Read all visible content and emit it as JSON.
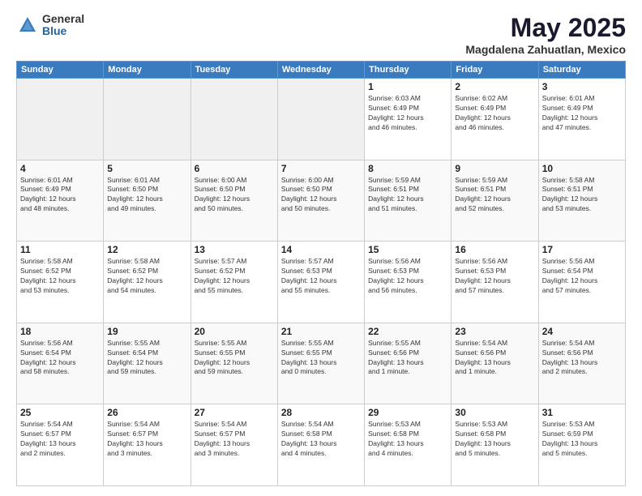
{
  "logo": {
    "general": "General",
    "blue": "Blue"
  },
  "title": {
    "month": "May 2025",
    "location": "Magdalena Zahuatlan, Mexico"
  },
  "days_of_week": [
    "Sunday",
    "Monday",
    "Tuesday",
    "Wednesday",
    "Thursday",
    "Friday",
    "Saturday"
  ],
  "weeks": [
    [
      {
        "day": "",
        "info": ""
      },
      {
        "day": "",
        "info": ""
      },
      {
        "day": "",
        "info": ""
      },
      {
        "day": "",
        "info": ""
      },
      {
        "day": "1",
        "info": "Sunrise: 6:03 AM\nSunset: 6:49 PM\nDaylight: 12 hours\nand 46 minutes."
      },
      {
        "day": "2",
        "info": "Sunrise: 6:02 AM\nSunset: 6:49 PM\nDaylight: 12 hours\nand 46 minutes."
      },
      {
        "day": "3",
        "info": "Sunrise: 6:01 AM\nSunset: 6:49 PM\nDaylight: 12 hours\nand 47 minutes."
      }
    ],
    [
      {
        "day": "4",
        "info": "Sunrise: 6:01 AM\nSunset: 6:49 PM\nDaylight: 12 hours\nand 48 minutes."
      },
      {
        "day": "5",
        "info": "Sunrise: 6:01 AM\nSunset: 6:50 PM\nDaylight: 12 hours\nand 49 minutes."
      },
      {
        "day": "6",
        "info": "Sunrise: 6:00 AM\nSunset: 6:50 PM\nDaylight: 12 hours\nand 50 minutes."
      },
      {
        "day": "7",
        "info": "Sunrise: 6:00 AM\nSunset: 6:50 PM\nDaylight: 12 hours\nand 50 minutes."
      },
      {
        "day": "8",
        "info": "Sunrise: 5:59 AM\nSunset: 6:51 PM\nDaylight: 12 hours\nand 51 minutes."
      },
      {
        "day": "9",
        "info": "Sunrise: 5:59 AM\nSunset: 6:51 PM\nDaylight: 12 hours\nand 52 minutes."
      },
      {
        "day": "10",
        "info": "Sunrise: 5:58 AM\nSunset: 6:51 PM\nDaylight: 12 hours\nand 53 minutes."
      }
    ],
    [
      {
        "day": "11",
        "info": "Sunrise: 5:58 AM\nSunset: 6:52 PM\nDaylight: 12 hours\nand 53 minutes."
      },
      {
        "day": "12",
        "info": "Sunrise: 5:58 AM\nSunset: 6:52 PM\nDaylight: 12 hours\nand 54 minutes."
      },
      {
        "day": "13",
        "info": "Sunrise: 5:57 AM\nSunset: 6:52 PM\nDaylight: 12 hours\nand 55 minutes."
      },
      {
        "day": "14",
        "info": "Sunrise: 5:57 AM\nSunset: 6:53 PM\nDaylight: 12 hours\nand 55 minutes."
      },
      {
        "day": "15",
        "info": "Sunrise: 5:56 AM\nSunset: 6:53 PM\nDaylight: 12 hours\nand 56 minutes."
      },
      {
        "day": "16",
        "info": "Sunrise: 5:56 AM\nSunset: 6:53 PM\nDaylight: 12 hours\nand 57 minutes."
      },
      {
        "day": "17",
        "info": "Sunrise: 5:56 AM\nSunset: 6:54 PM\nDaylight: 12 hours\nand 57 minutes."
      }
    ],
    [
      {
        "day": "18",
        "info": "Sunrise: 5:56 AM\nSunset: 6:54 PM\nDaylight: 12 hours\nand 58 minutes."
      },
      {
        "day": "19",
        "info": "Sunrise: 5:55 AM\nSunset: 6:54 PM\nDaylight: 12 hours\nand 59 minutes."
      },
      {
        "day": "20",
        "info": "Sunrise: 5:55 AM\nSunset: 6:55 PM\nDaylight: 12 hours\nand 59 minutes."
      },
      {
        "day": "21",
        "info": "Sunrise: 5:55 AM\nSunset: 6:55 PM\nDaylight: 13 hours\nand 0 minutes."
      },
      {
        "day": "22",
        "info": "Sunrise: 5:55 AM\nSunset: 6:56 PM\nDaylight: 13 hours\nand 1 minute."
      },
      {
        "day": "23",
        "info": "Sunrise: 5:54 AM\nSunset: 6:56 PM\nDaylight: 13 hours\nand 1 minute."
      },
      {
        "day": "24",
        "info": "Sunrise: 5:54 AM\nSunset: 6:56 PM\nDaylight: 13 hours\nand 2 minutes."
      }
    ],
    [
      {
        "day": "25",
        "info": "Sunrise: 5:54 AM\nSunset: 6:57 PM\nDaylight: 13 hours\nand 2 minutes."
      },
      {
        "day": "26",
        "info": "Sunrise: 5:54 AM\nSunset: 6:57 PM\nDaylight: 13 hours\nand 3 minutes."
      },
      {
        "day": "27",
        "info": "Sunrise: 5:54 AM\nSunset: 6:57 PM\nDaylight: 13 hours\nand 3 minutes."
      },
      {
        "day": "28",
        "info": "Sunrise: 5:54 AM\nSunset: 6:58 PM\nDaylight: 13 hours\nand 4 minutes."
      },
      {
        "day": "29",
        "info": "Sunrise: 5:53 AM\nSunset: 6:58 PM\nDaylight: 13 hours\nand 4 minutes."
      },
      {
        "day": "30",
        "info": "Sunrise: 5:53 AM\nSunset: 6:58 PM\nDaylight: 13 hours\nand 5 minutes."
      },
      {
        "day": "31",
        "info": "Sunrise: 5:53 AM\nSunset: 6:59 PM\nDaylight: 13 hours\nand 5 minutes."
      }
    ]
  ]
}
